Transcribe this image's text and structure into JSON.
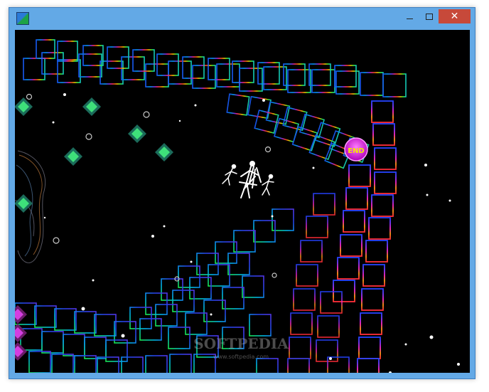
{
  "window": {
    "title": "",
    "icon_name": "app-icon",
    "controls": {
      "minimize_icon": "minimize-icon",
      "maximize_icon": "maximize-icon",
      "close_icon": "close-icon",
      "close_glyph": "✕"
    }
  },
  "game": {
    "end_marker_label": "END",
    "watermark": "SOFTPEDIA",
    "watermark_url": "www.softpedia.com",
    "colors": {
      "background": "#000000",
      "end_marker": "#d42bd4",
      "end_text": "#f3e600",
      "gem_light": "#3ee07a",
      "gem_dark": "#1b6b5a",
      "titlebar": "#63a9e6",
      "close": "#c7493a"
    },
    "gem_count": 9,
    "stick_figures": 3
  }
}
